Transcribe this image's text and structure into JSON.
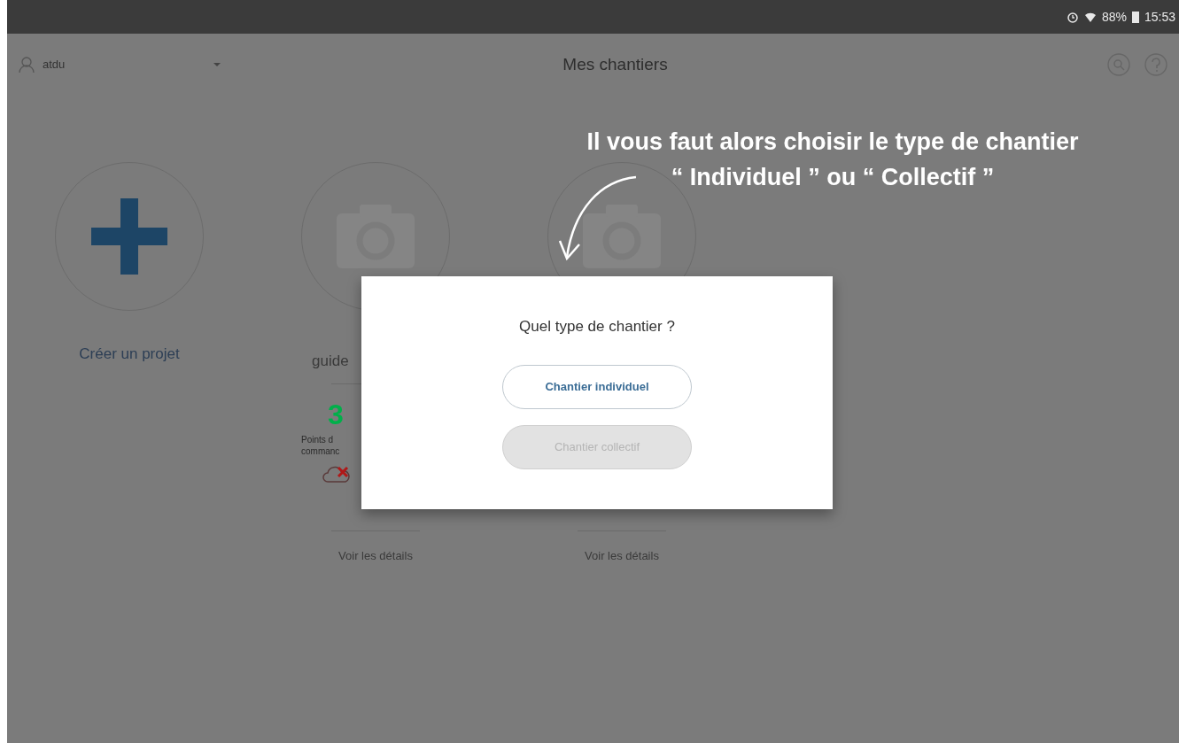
{
  "status_bar": {
    "battery": "88%",
    "time": "15:53"
  },
  "header": {
    "user": "atdu",
    "title": "Mes chantiers"
  },
  "projects": [
    {
      "kind": "create",
      "label": "Créer un projet"
    },
    {
      "kind": "site",
      "name": "guide",
      "count": "3",
      "count_label_lines": [
        "Points d",
        "commanc"
      ],
      "sync_failed": true,
      "details_link": "Voir les détails"
    },
    {
      "kind": "site",
      "details_link": "Voir les détails"
    }
  ],
  "annotation": {
    "lines": [
      "Il vous faut alors choisir le type de chantier",
      "“ Individuel ” ou “ Collectif ”"
    ]
  },
  "dialog": {
    "title": "Quel type de chantier ?",
    "buttons": [
      {
        "label": "Chantier individuel",
        "disabled": false
      },
      {
        "label": "Chantier collectif",
        "disabled": true
      }
    ]
  }
}
